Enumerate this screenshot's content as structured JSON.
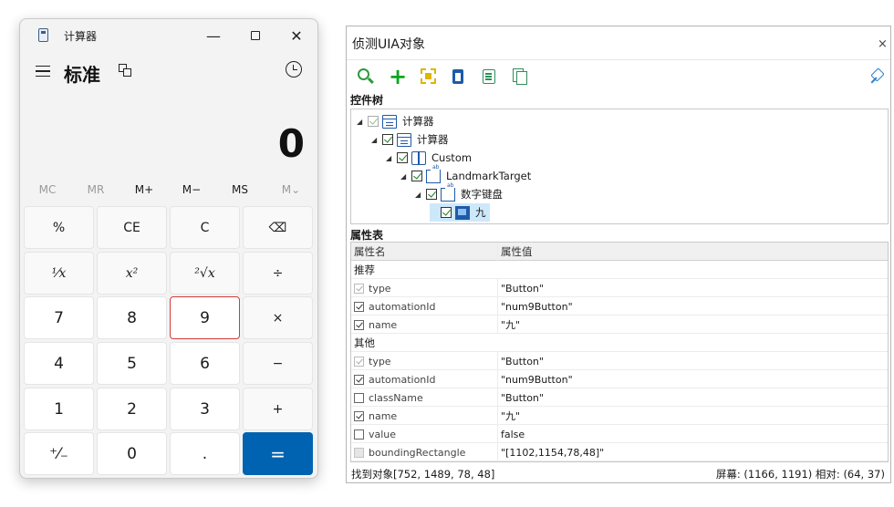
{
  "calculator": {
    "window_title": "计算器",
    "window_buttons": {
      "minimize": "—",
      "close": "✕"
    },
    "mode": "标准",
    "display": "0",
    "memory": [
      {
        "label": "MC",
        "enabled": false
      },
      {
        "label": "MR",
        "enabled": false
      },
      {
        "label": "M+",
        "enabled": true
      },
      {
        "label": "M−",
        "enabled": true
      },
      {
        "label": "MS",
        "enabled": true
      },
      {
        "label": "M⌄",
        "enabled": false
      }
    ],
    "keys": [
      [
        "%",
        "CE",
        "C",
        "⌫"
      ],
      [
        "¹⁄x",
        "x²",
        "²√x",
        "÷"
      ],
      [
        "7",
        "8",
        "9",
        "×"
      ],
      [
        "4",
        "5",
        "6",
        "−"
      ],
      [
        "1",
        "2",
        "3",
        "+"
      ],
      [
        "⁺⁄₋",
        "0",
        ".",
        "="
      ]
    ],
    "selected_key": "9",
    "accent_color": "#0063b1",
    "highlight_color": "#d33a3a"
  },
  "inspector": {
    "title": "侦测UIA对象",
    "close": "×",
    "toolbar_icons": [
      "search-icon",
      "add-icon",
      "target-icon",
      "clipboard-icon",
      "list-icon",
      "copy-icon",
      "pin-icon"
    ],
    "tree_label": "控件树",
    "tree": [
      {
        "label": "计算器",
        "icon": "window-icon",
        "checked": true,
        "grey": true
      },
      {
        "label": "计算器",
        "icon": "window-icon",
        "checked": true,
        "grey": false
      },
      {
        "label": "Custom",
        "icon": "cube-icon",
        "checked": true,
        "grey": false
      },
      {
        "label": "LandmarkTarget",
        "icon": "group-icon",
        "checked": true,
        "grey": false
      },
      {
        "label": "数字键盘",
        "icon": "group-icon",
        "checked": true,
        "grey": false
      },
      {
        "label": "九",
        "icon": "button-icon",
        "checked": true,
        "grey": false,
        "selected": true
      }
    ],
    "props_label": "属性表",
    "props_headers": [
      "属性名",
      "属性值"
    ],
    "props_groups": [
      {
        "name": "推荐",
        "rows": [
          {
            "name": "type",
            "value": "\"Button\"",
            "checked": true,
            "grey": true
          },
          {
            "name": "automationId",
            "value": "\"num9Button\"",
            "checked": true,
            "grey": false
          },
          {
            "name": "name",
            "value": "\"九\"",
            "checked": true,
            "grey": false
          }
        ]
      },
      {
        "name": "其他",
        "rows": [
          {
            "name": "type",
            "value": "\"Button\"",
            "checked": true,
            "grey": true
          },
          {
            "name": "automationId",
            "value": "\"num9Button\"",
            "checked": true,
            "grey": false
          },
          {
            "name": "className",
            "value": "\"Button\"",
            "checked": false,
            "grey": false
          },
          {
            "name": "name",
            "value": "\"九\"",
            "checked": true,
            "grey": false
          },
          {
            "name": "value",
            "value": "false",
            "checked": false,
            "grey": false
          },
          {
            "name": "boundingRectangle",
            "value": "\"[1102,1154,78,48]\"",
            "checked": false,
            "grey": true
          }
        ]
      }
    ],
    "status_left": "找到对象[752, 1489, 78, 48]",
    "status_right": "屏幕: (1166, 1191)   相对: (64, 37)"
  }
}
